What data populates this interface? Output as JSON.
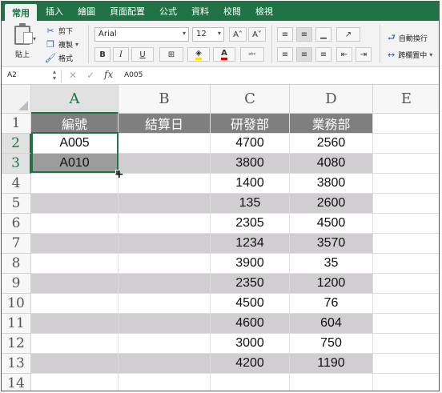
{
  "ribbon_tabs": [
    "常用",
    "插入",
    "繪圖",
    "頁面配置",
    "公式",
    "資料",
    "校閱",
    "檢視"
  ],
  "ribbon": {
    "paste_label": "貼上",
    "cut_label": "剪下",
    "copy_label": "複製",
    "format_label": "格式",
    "font_name": "Arial",
    "font_size": "12",
    "grow_font": "A˄",
    "shrink_font": "A˅",
    "bold": "B",
    "italic": "I",
    "underline": "U",
    "wrap_text_label": "自動換行",
    "merge_center_label": "跨欄置中"
  },
  "formula_bar": {
    "name_box": "A2",
    "fx_label": "fx",
    "value": "A005"
  },
  "columns": [
    "A",
    "B",
    "C",
    "D",
    "E"
  ],
  "rows": [
    "1",
    "2",
    "3",
    "4",
    "5",
    "6",
    "7",
    "8",
    "9",
    "10",
    "11",
    "12",
    "13",
    "14"
  ],
  "table": {
    "headers": [
      "編號",
      "結算日",
      "研發部",
      "業務部"
    ],
    "data": [
      [
        "A005",
        "",
        "4700",
        "2560"
      ],
      [
        "A010",
        "",
        "3800",
        "4080"
      ],
      [
        "",
        "",
        "1400",
        "3800"
      ],
      [
        "",
        "",
        "135",
        "2600"
      ],
      [
        "",
        "",
        "2305",
        "4500"
      ],
      [
        "",
        "",
        "1234",
        "3570"
      ],
      [
        "",
        "",
        "3900",
        "35"
      ],
      [
        "",
        "",
        "2350",
        "1200"
      ],
      [
        "",
        "",
        "4500",
        "76"
      ],
      [
        "",
        "",
        "4600",
        "604"
      ],
      [
        "",
        "",
        "3000",
        "750"
      ],
      [
        "",
        "",
        "4200",
        "1190"
      ],
      [
        "",
        "",
        "",
        ""
      ]
    ]
  },
  "colors": {
    "accent": "#217346",
    "header_fill": "#7f7f7f",
    "band_fill": "#d0ced0"
  }
}
